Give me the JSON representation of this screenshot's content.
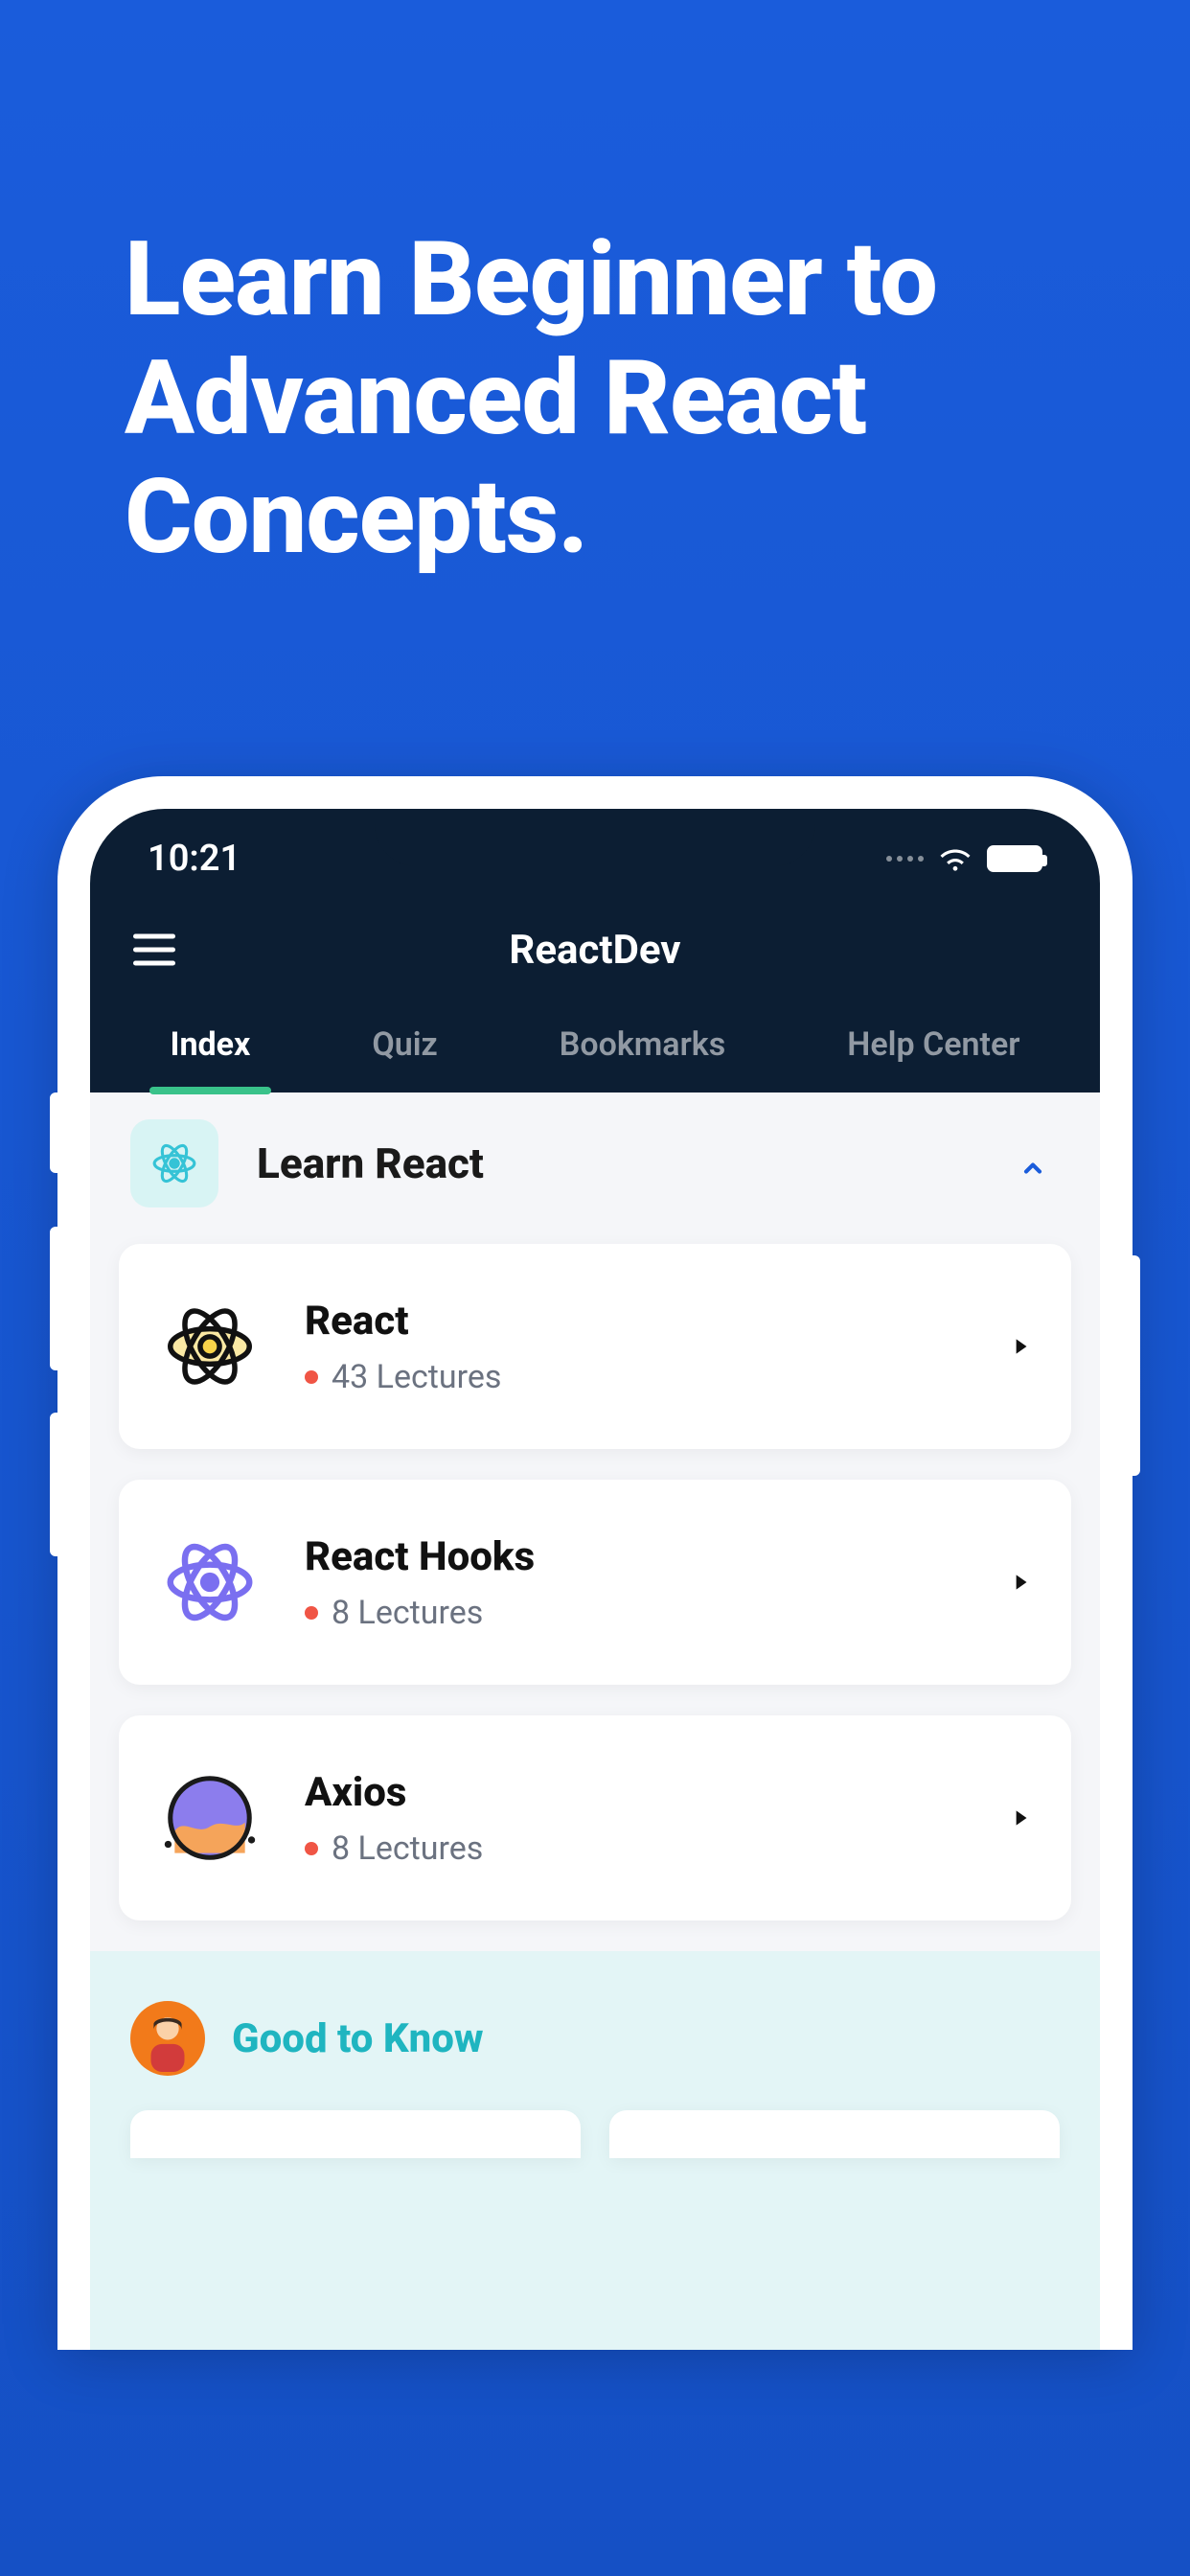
{
  "hero": {
    "title": "Learn Beginner to Advanced React Concepts."
  },
  "statusBar": {
    "time": "10:21"
  },
  "app": {
    "title": "ReactDev"
  },
  "tabs": [
    {
      "label": "Index",
      "active": true
    },
    {
      "label": "Quiz",
      "active": false
    },
    {
      "label": "Bookmarks",
      "active": false
    },
    {
      "label": "Help Center",
      "active": false
    }
  ],
  "section": {
    "title": "Learn React",
    "expanded": true
  },
  "courses": [
    {
      "title": "React",
      "lectures": "43 Lectures",
      "iconColor": "#f4c534",
      "iconStroke": "#111"
    },
    {
      "title": "React Hooks",
      "lectures": "8 Lectures",
      "iconColor": "#7a6ff0",
      "iconStroke": "#7a6ff0"
    },
    {
      "title": "Axios",
      "lectures": "8 Lectures",
      "iconColor": "#f27a1a",
      "iconStroke": "#111"
    }
  ],
  "goodToKnow": {
    "title": "Good to Know"
  },
  "colors": {
    "primary": "#1A5CDB",
    "accent": "#39c28a",
    "teal": "#1fb5c0",
    "danger": "#f05545"
  }
}
